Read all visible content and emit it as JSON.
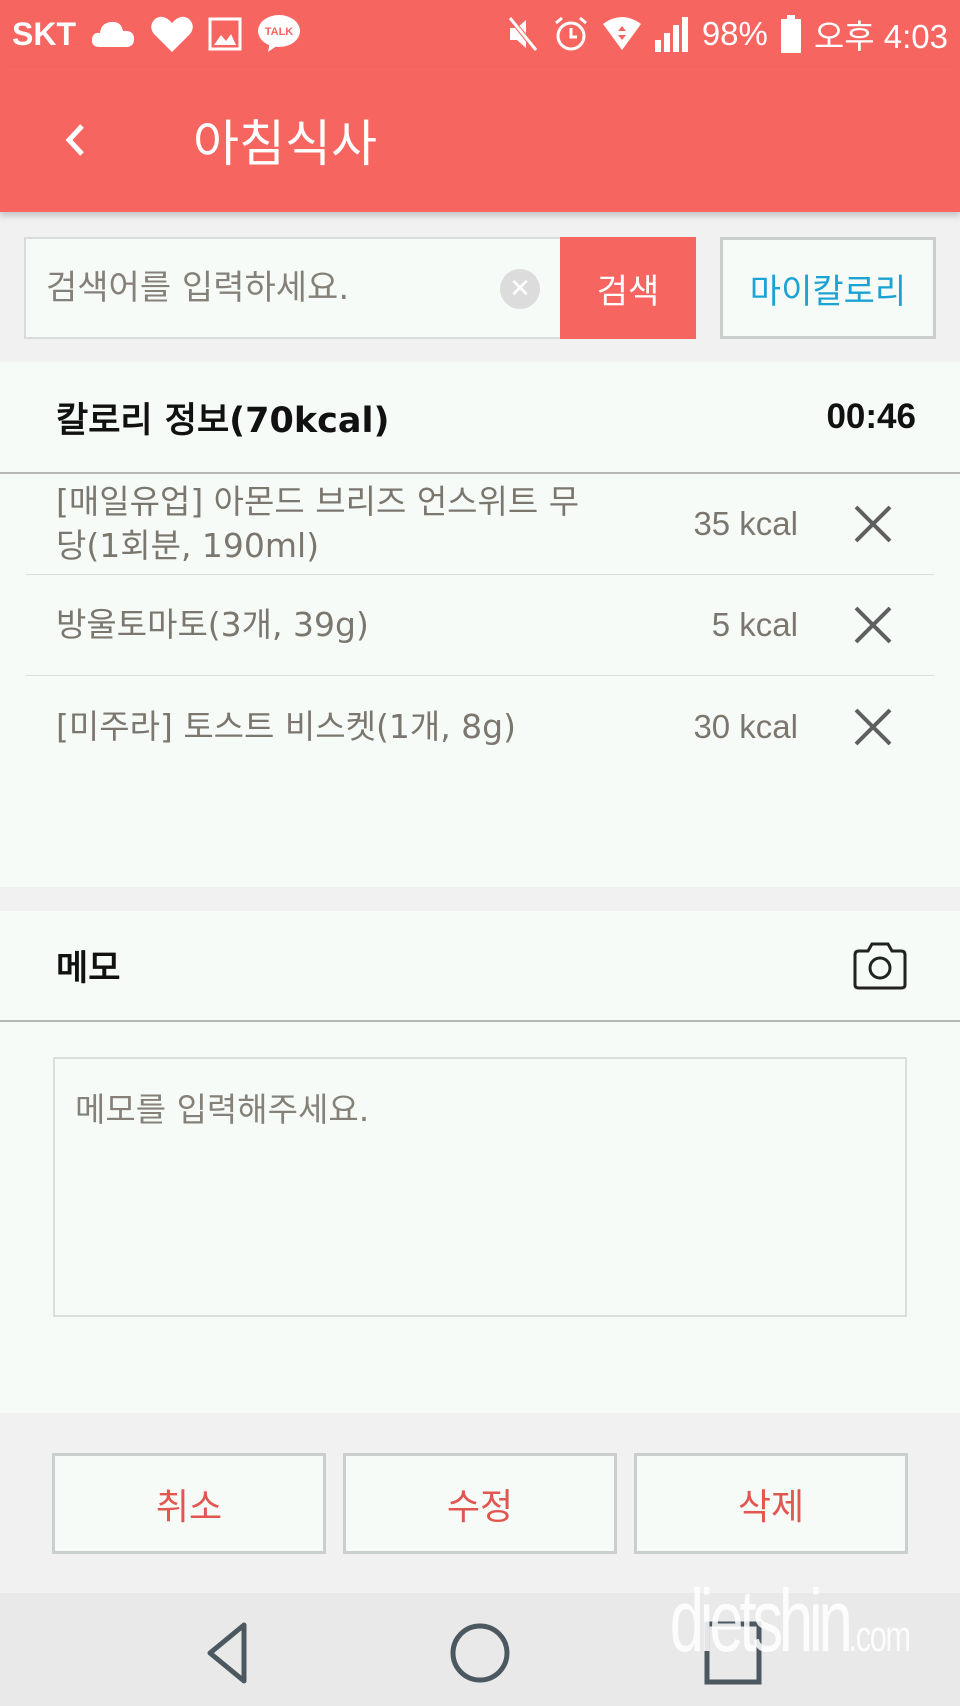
{
  "status_bar": {
    "carrier": "SKT",
    "notification_icons": [
      "cloud-icon",
      "heart-icon",
      "image-icon",
      "kakaotalk-icon"
    ],
    "kakaotalk_label": "TALK",
    "system_icons": [
      "mute-icon",
      "alarm-icon",
      "wifi-icon",
      "signal-icon"
    ],
    "battery": "98%",
    "time": "오후 4:03"
  },
  "app_bar": {
    "title": "아침식사",
    "back_icon": "chevron-left-icon"
  },
  "search": {
    "placeholder": "검색어를 입력하세요.",
    "value": "",
    "search_label": "검색",
    "my_calorie_label": "마이칼로리"
  },
  "calorie_info": {
    "title": "칼로리 정보(70kcal)",
    "time": "00:46",
    "items": [
      {
        "name": "[매일유업] 아몬드 브리즈 언스위트 무당(1회분, 190ml)",
        "kcal": "35 kcal"
      },
      {
        "name": "방울토마토(3개, 39g)",
        "kcal": "5 kcal"
      },
      {
        "name": "[미주라] 토스트 비스켓(1개, 8g)",
        "kcal": "30 kcal"
      }
    ]
  },
  "memo": {
    "title": "메모",
    "placeholder": "메모를 입력해주세요.",
    "value": ""
  },
  "actions": {
    "cancel": "취소",
    "edit": "수정",
    "delete": "삭제"
  },
  "nav": {
    "back": "nav-back-icon",
    "home": "nav-home-icon",
    "recents": "nav-recents-icon"
  },
  "watermark": {
    "main": "dietshin",
    "suffix": ".com"
  },
  "colors": {
    "brand": "#f76561",
    "accent_blue": "#1ba3d4",
    "action_text": "#e1574f"
  }
}
